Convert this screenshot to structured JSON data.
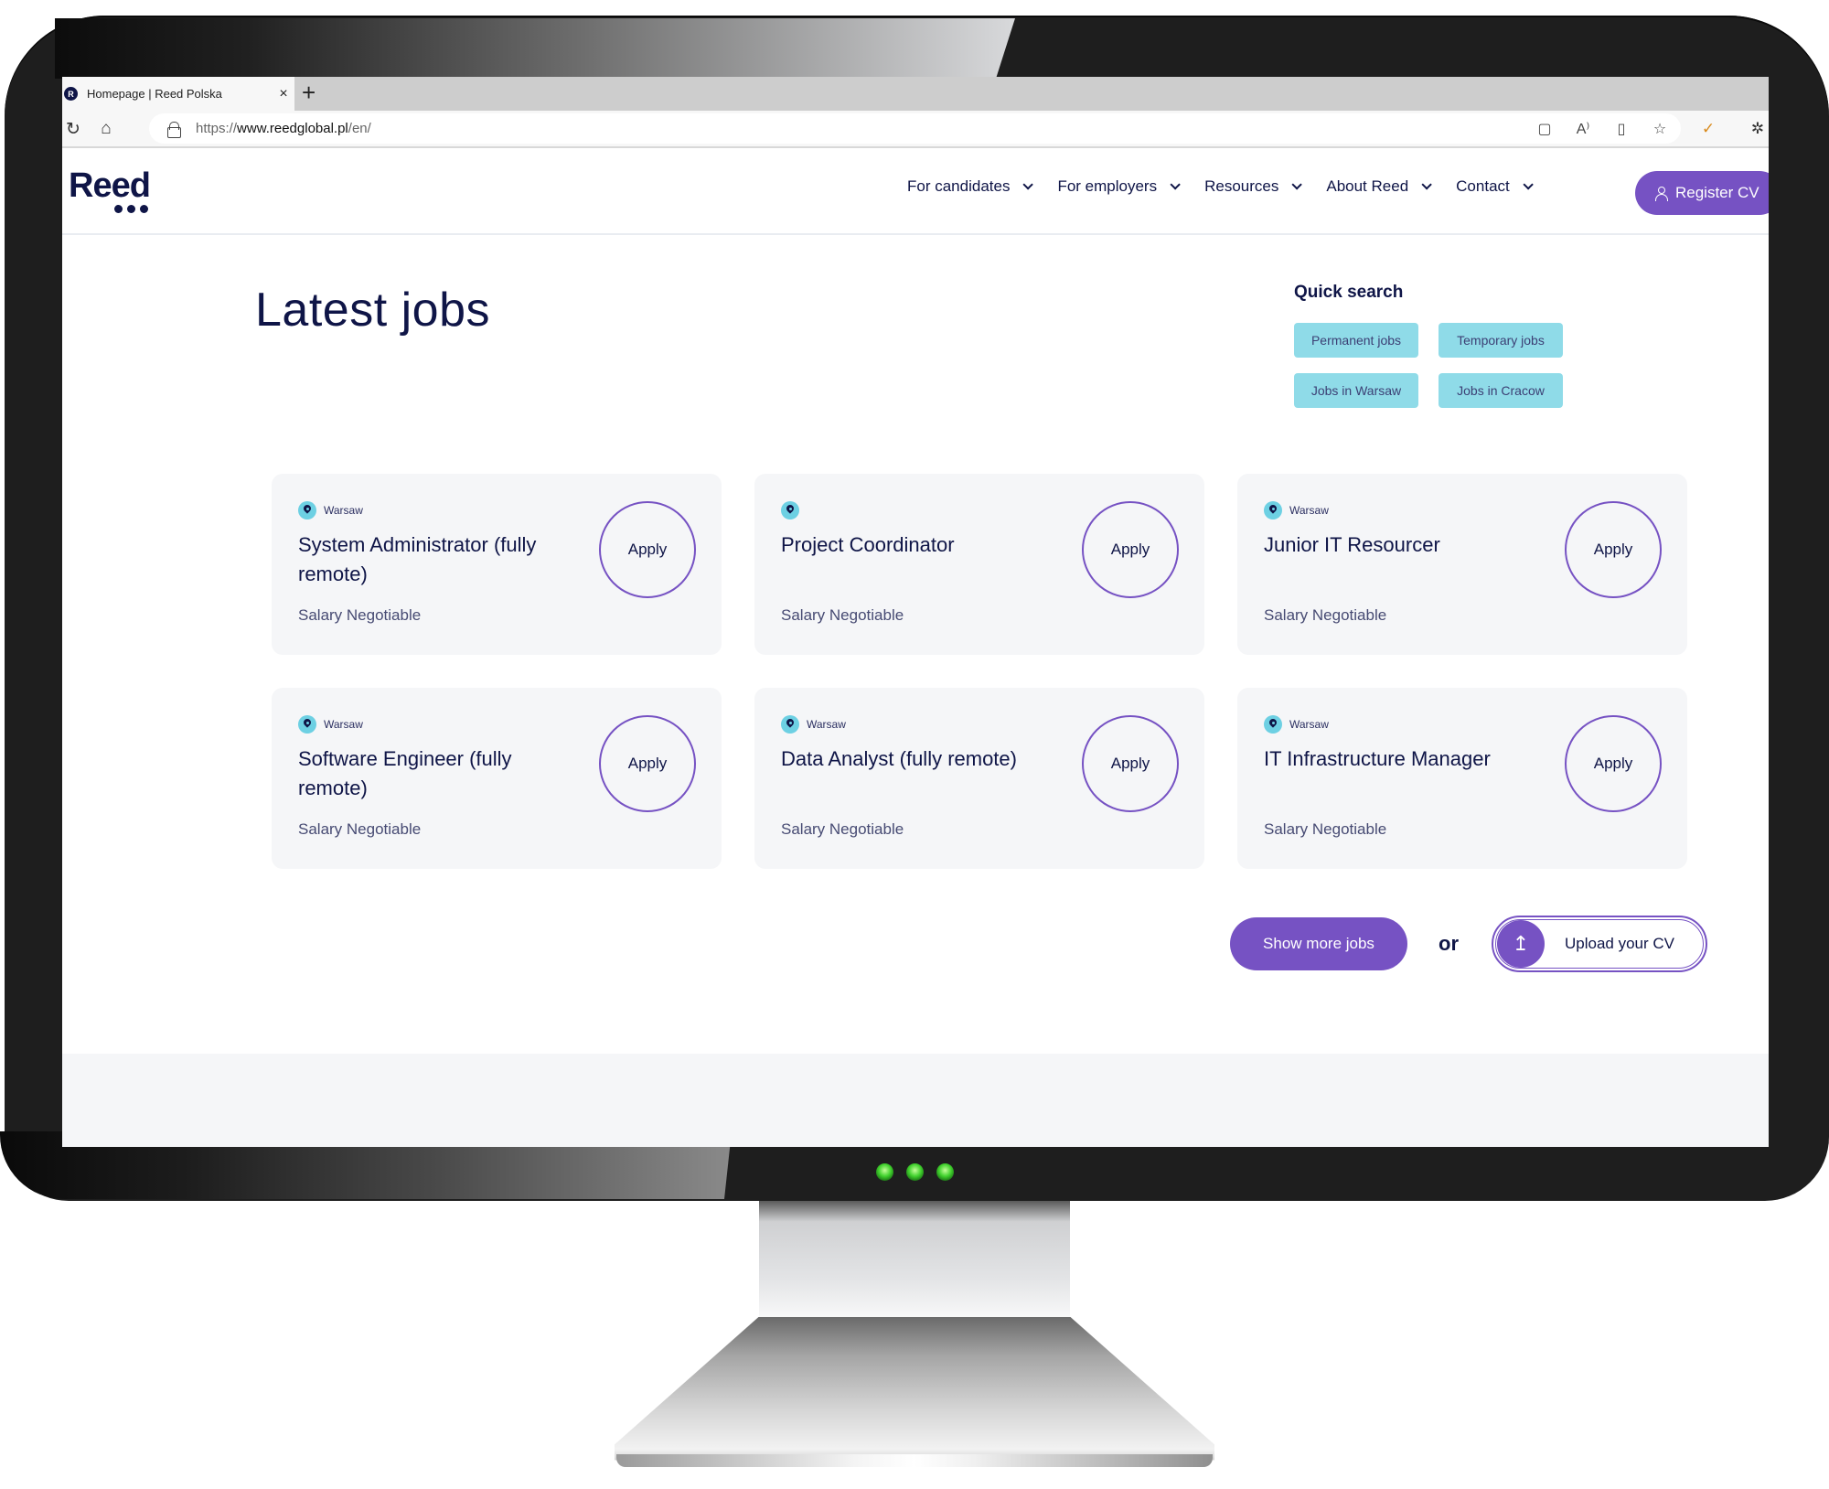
{
  "browser": {
    "tab_title": "Homepage | Reed Polska",
    "favicon_letter": "R",
    "close_glyph": "×",
    "new_tab_glyph": "+",
    "url_prefix": "https://",
    "url_host": "www.reedglobal.pl",
    "url_path": "/en/",
    "nav_icons": {
      "reload": "↻",
      "home": "⌂"
    },
    "omnibox_icons": [
      {
        "name": "briefcase-icon",
        "glyph": "▢"
      },
      {
        "name": "read-aloud-icon",
        "glyph": "A⁾"
      },
      {
        "name": "immersive-reader-icon",
        "glyph": "▯"
      },
      {
        "name": "add-favorite-icon",
        "glyph": "☆"
      }
    ],
    "extension_icons": [
      {
        "name": "extension-app-icon",
        "glyph": "✓"
      },
      {
        "name": "extensions-puzzle-icon",
        "glyph": "✲"
      }
    ]
  },
  "header": {
    "logo_text": "Reed",
    "nav": [
      {
        "label": "For candidates"
      },
      {
        "label": "For employers"
      },
      {
        "label": "Resources"
      },
      {
        "label": "About Reed"
      },
      {
        "label": "Contact"
      }
    ],
    "register_label": "Register CV"
  },
  "main": {
    "title": "Latest jobs",
    "quick_search": {
      "title": "Quick search",
      "chips": [
        "Permanent jobs",
        "Temporary jobs",
        "Jobs in Warsaw",
        "Jobs in Cracow"
      ]
    },
    "jobs": [
      {
        "location": "Warsaw",
        "title": "System Administrator (fully remote)",
        "salary": "Salary Negotiable",
        "apply": "Apply"
      },
      {
        "location": "",
        "title": "Project Coordinator",
        "salary": "Salary Negotiable",
        "apply": "Apply"
      },
      {
        "location": "Warsaw",
        "title": "Junior IT Resourcer",
        "salary": "Salary Negotiable",
        "apply": "Apply"
      },
      {
        "location": "Warsaw",
        "title": "Software Engineer (fully remote)",
        "salary": "Salary Negotiable",
        "apply": "Apply"
      },
      {
        "location": "Warsaw",
        "title": "Data Analyst (fully remote)",
        "salary": "Salary Negotiable",
        "apply": "Apply"
      },
      {
        "location": "Warsaw",
        "title": "IT Infrastructure Manager",
        "salary": "Salary Negotiable",
        "apply": "Apply"
      }
    ],
    "show_more_label": "Show more jobs",
    "or_label": "or",
    "upload_label": "Upload your CV",
    "upload_glyph": "↥"
  },
  "colors": {
    "brand_navy": "#0f1547",
    "accent_purple": "#7652c3",
    "chip_cyan": "#8fdbe8",
    "card_bg": "#f5f6f8",
    "pin_cyan": "#6dd0e3"
  }
}
